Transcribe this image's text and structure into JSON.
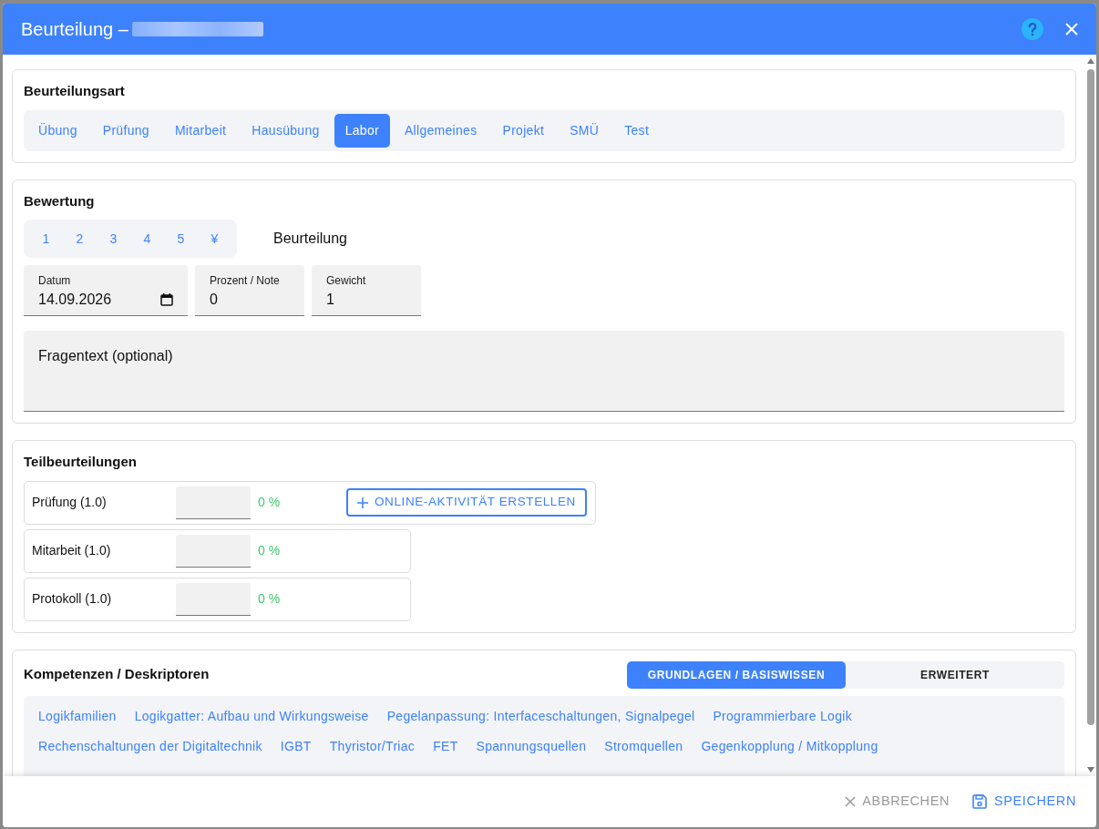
{
  "dialog": {
    "title": "Beurteilung –"
  },
  "type_section": {
    "title": "Beurteilungsart",
    "tabs": [
      {
        "label": "Übung",
        "selected": false
      },
      {
        "label": "Prüfung",
        "selected": false
      },
      {
        "label": "Mitarbeit",
        "selected": false
      },
      {
        "label": "Hausübung",
        "selected": false
      },
      {
        "label": "Labor",
        "selected": true
      },
      {
        "label": "Allgemeines",
        "selected": false
      },
      {
        "label": "Projekt",
        "selected": false
      },
      {
        "label": "SMÜ",
        "selected": false
      },
      {
        "label": "Test",
        "selected": false
      }
    ]
  },
  "rating_section": {
    "title": "Bewertung",
    "grades": [
      {
        "label": "1",
        "selected": false
      },
      {
        "label": "2",
        "selected": false
      },
      {
        "label": "3",
        "selected": false
      },
      {
        "label": "4",
        "selected": false
      },
      {
        "label": "5",
        "selected": false
      },
      {
        "label": "¥",
        "selected": false
      }
    ],
    "grade_label": "Beurteilung",
    "fields": [
      {
        "label": "Datum",
        "value": "14.09.2026",
        "kind": "date"
      },
      {
        "label": "Prozent / Note",
        "value": "0",
        "kind": "text"
      },
      {
        "label": "Gewicht",
        "value": "1",
        "kind": "text"
      }
    ],
    "question": {
      "placeholder": "Fragentext (optional)"
    }
  },
  "partial_section": {
    "title": "Teilbeurteilungen",
    "rows": [
      {
        "name": "Prüfung (1.0)",
        "percent": "0 %",
        "action": "ONLINE-AKTIVITÄT ERSTELLEN"
      },
      {
        "name": "Mitarbeit (1.0)",
        "percent": "0 %"
      },
      {
        "name": "Protokoll (1.0)",
        "percent": "0 %"
      }
    ]
  },
  "competence_section": {
    "title": "Kompetenzen / Deskriptoren",
    "toggle": [
      {
        "label": "GRUNDLAGEN / BASISWISSEN",
        "selected": true
      },
      {
        "label": "ERWEITERT",
        "selected": false
      }
    ],
    "chips": [
      "Logikfamilien",
      "Logikgatter: Aufbau und Wirkungsweise",
      "Pegelanpassung: Interfaceschaltungen, Signalpegel",
      "Programmierbare Logik",
      "Rechenschaltungen der Digitaltechnik",
      "IGBT",
      "Thyristor/Triac",
      "FET",
      "Spannungsquellen",
      "Stromquellen",
      "Gegenkopplung / Mitkopplung"
    ]
  },
  "footer": {
    "buttons": [
      {
        "label": "ABBRECHEN",
        "kind": "cancel"
      },
      {
        "label": "SPEICHERN",
        "kind": "save"
      }
    ]
  }
}
